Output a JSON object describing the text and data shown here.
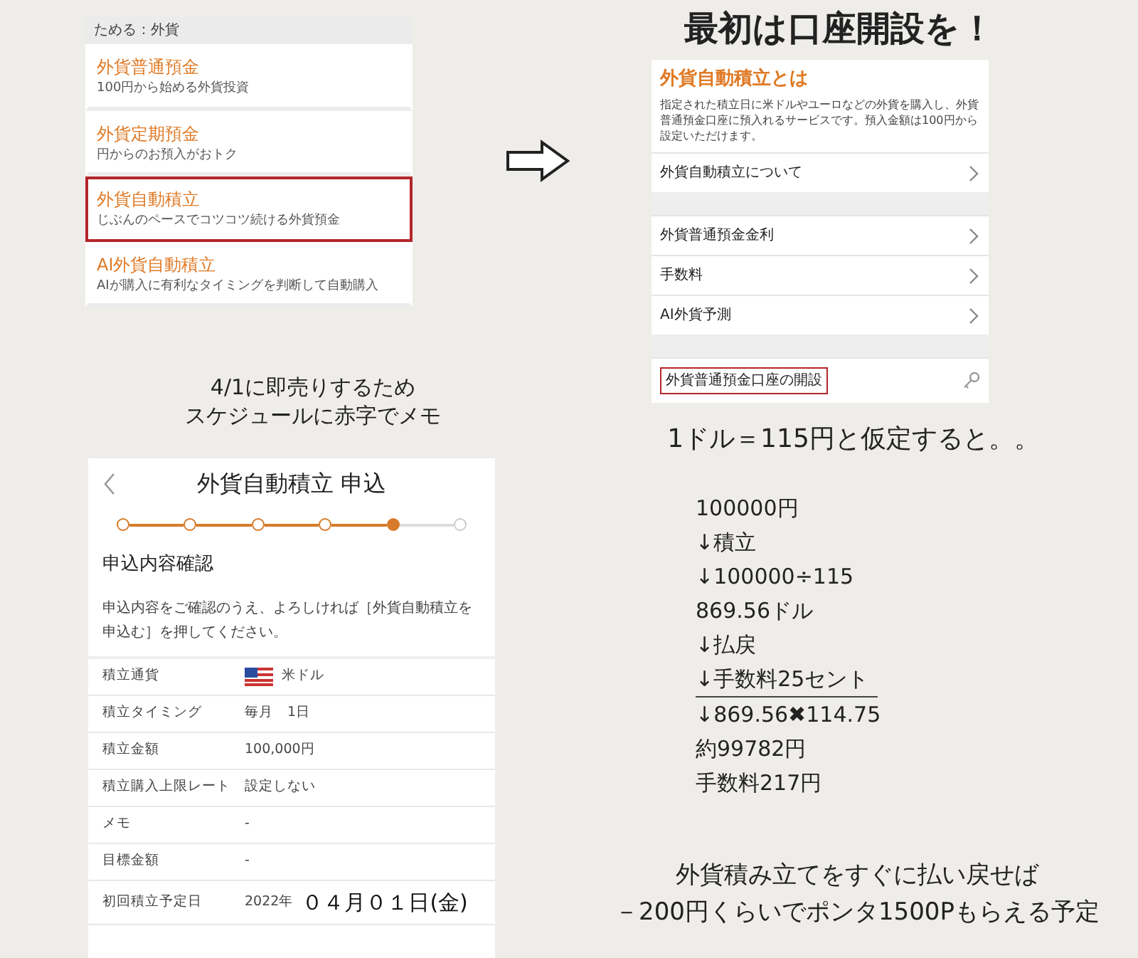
{
  "menu_panel": {
    "header": "ためる：外貨",
    "items": [
      {
        "title": "外貨普通預金",
        "subtitle": "100円から始める外貨投資",
        "highlighted": false
      },
      {
        "title": "外貨定期預金",
        "subtitle": "円からのお預入がおトク",
        "highlighted": false
      },
      {
        "title": "外貨自動積立",
        "subtitle": "じぶんのペースでコツコツ続ける外貨預金",
        "highlighted": true
      },
      {
        "title": "AI外貨自動積立",
        "subtitle": "AIが購入に有利なタイミングを判断して自動購入",
        "highlighted": false
      }
    ]
  },
  "headline": "最初は口座開設を！",
  "info_panel": {
    "title": "外貨自動積立とは",
    "description": "指定された積立日に米ドルやユーロなどの外貨を購入し、外貨普通預金口座に預入れるサービスです。預入金額は100円から設定いただけます。",
    "sections": [
      [
        {
          "label": "外貨自動積立について",
          "kind": "link",
          "highlighted": false
        }
      ],
      [
        {
          "label": "外貨普通預金金利",
          "kind": "link",
          "highlighted": false
        },
        {
          "label": "手数料",
          "kind": "link",
          "highlighted": false
        },
        {
          "label": "AI外貨予測",
          "kind": "link",
          "highlighted": false
        }
      ],
      [
        {
          "label": "外貨普通預金口座の開設",
          "kind": "locked",
          "highlighted": true
        }
      ]
    ]
  },
  "caption": [
    "4/1に即売りするため",
    "スケジュールに赤字でメモ"
  ],
  "form_panel": {
    "title": "外貨自動積立 申込",
    "steps": [
      {
        "completed": true,
        "current": false
      },
      {
        "completed": true,
        "current": false
      },
      {
        "completed": true,
        "current": false
      },
      {
        "completed": true,
        "current": false
      },
      {
        "completed": false,
        "current": true
      },
      {
        "completed": false,
        "current": false
      }
    ],
    "section_title": "申込内容確認",
    "instruction": "申込内容をご確認のうえ、よろしければ［外貨自動積立を申込む］を押してください。",
    "rows": [
      {
        "label": "積立通貨",
        "value": "米ドル",
        "flag": true
      },
      {
        "label": "積立タイミング",
        "value": "毎月　1日",
        "flag": false
      },
      {
        "label": "積立金額",
        "value": "100,000円",
        "flag": false
      },
      {
        "label": "積立購入上限レート",
        "value": "設定しない",
        "flag": false
      },
      {
        "label": "メモ",
        "value": "-",
        "flag": false
      },
      {
        "label": "目標金額",
        "value": "-",
        "flag": false
      },
      {
        "label": "初回積立予定日",
        "value": "2022年",
        "annotation": "０４月０１日(金)",
        "flag": false
      }
    ]
  },
  "assumption": "1ドル＝115円と仮定すると。。",
  "calculation": [
    {
      "text": "100000円",
      "underlined": false
    },
    {
      "text": "↓積立",
      "underlined": false
    },
    {
      "text": "↓100000÷115",
      "underlined": false
    },
    {
      "text": "869.56ドル",
      "underlined": false
    },
    {
      "text": "↓払戻",
      "underlined": false
    },
    {
      "text": "↓手数料25セント",
      "underlined": true
    },
    {
      "text": "↓869.56✖114.75",
      "underlined": false
    },
    {
      "text": "約99782円",
      "underlined": false
    },
    {
      "text": "手数料217円",
      "underlined": false
    }
  ],
  "conclusion": [
    "外貨積み立てをすぐに払い戻せば",
    "－200円くらいでポンタ1500Pもらえる予定"
  ]
}
